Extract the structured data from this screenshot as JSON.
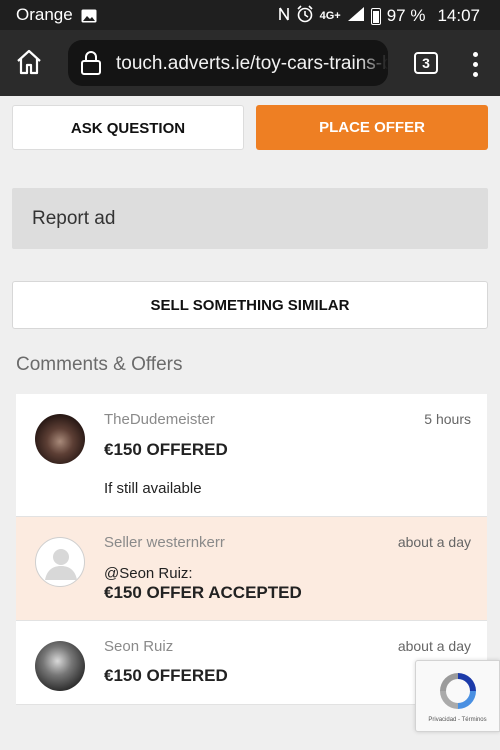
{
  "status_bar": {
    "carrier": "Orange",
    "network": "4G+",
    "battery": "97 %",
    "time": "14:07"
  },
  "browser": {
    "url": "touch.adverts.ie/toy-cars-trains-bo",
    "tab_count": "3"
  },
  "actions": {
    "ask_question": "ASK QUESTION",
    "place_offer": "PLACE OFFER",
    "report_ad": "Report ad",
    "sell_similar": "SELL SOMETHING SIMILAR"
  },
  "comments_section": {
    "title": "Comments & Offers",
    "items": [
      {
        "name": "TheDudemeister",
        "time": "5 hours",
        "offer": "€150 OFFERED",
        "text": "If still available"
      },
      {
        "name": "Seller westernkerr",
        "time": "about a day",
        "mention": "@Seon Ruiz:",
        "offer": "€150 OFFER ACCEPTED"
      },
      {
        "name": "Seon Ruiz",
        "time": "about a day",
        "offer": "€150 OFFERED"
      }
    ]
  },
  "recaptcha": {
    "footer": "Privacidad - Términos"
  },
  "colors": {
    "accent_orange": "#ee7f23",
    "highlight": "#fcebe0"
  }
}
